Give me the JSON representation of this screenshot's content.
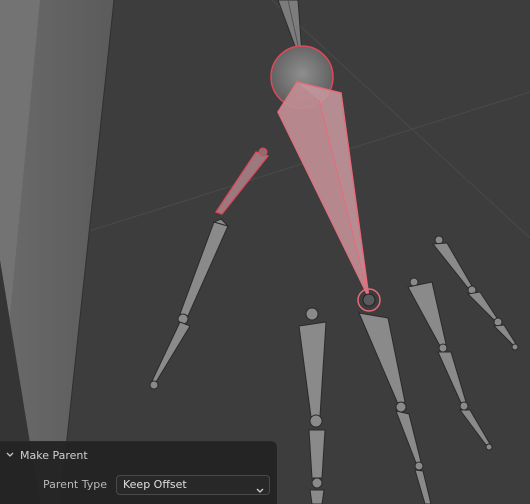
{
  "viewport": {
    "name": "3D Viewport",
    "selected_color": "#e0475a",
    "bone_color": "#8a8a8a"
  },
  "operator_panel": {
    "title": "Make Parent",
    "parent_type_label": "Parent Type",
    "parent_type_value": "Keep Offset",
    "collapse_icon": "chevron-down-icon",
    "dropdown_icon": "chevron-down-icon"
  }
}
